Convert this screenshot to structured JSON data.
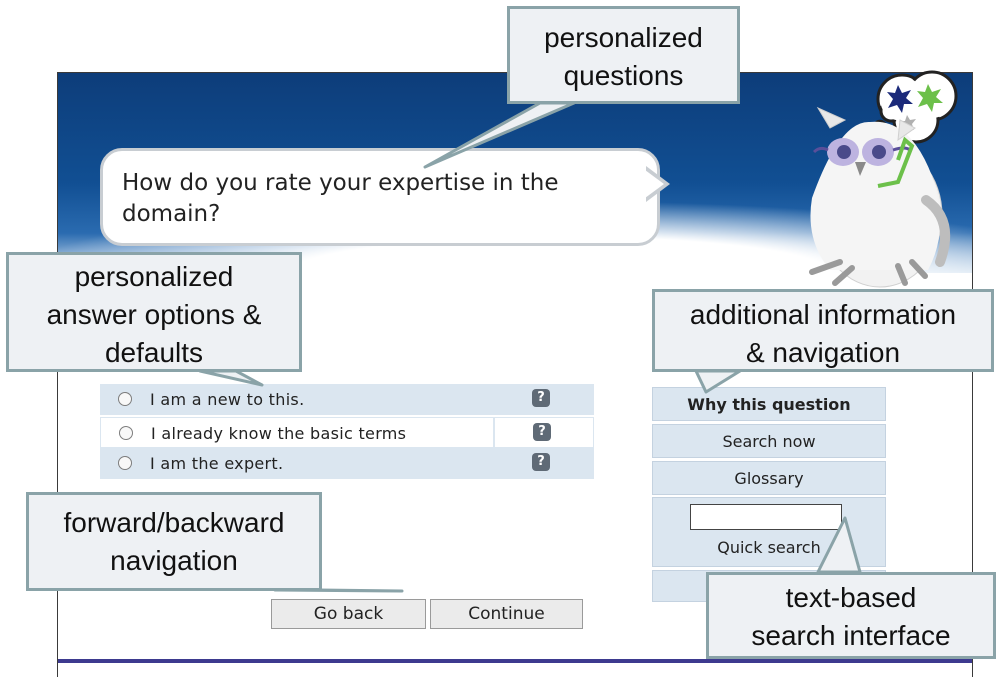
{
  "question": {
    "text": "How do you rate your expertise in the domain?"
  },
  "answers": [
    {
      "label": "I am a new to this.",
      "help": "?"
    },
    {
      "label": "I already know the basic terms",
      "help": "?"
    },
    {
      "label": "I am the expert.",
      "help": "?"
    }
  ],
  "nav": {
    "back_label": "Go back",
    "continue_label": "Continue"
  },
  "side": {
    "why_label": "Why this question",
    "search_now_label": "Search now",
    "glossary_label": "Glossary",
    "quick_search_label": "Quick search",
    "quick_search_value": ""
  },
  "callouts": {
    "personalized_questions": [
      "personalized",
      "questions"
    ],
    "answer_options": [
      "personalized",
      "answer options &",
      "defaults"
    ],
    "additional_info": [
      "additional information",
      "& navigation"
    ],
    "forward_backward": [
      "forward/backward",
      "navigation"
    ],
    "text_search": [
      "text-based",
      "search interface"
    ]
  },
  "colors": {
    "header_blue": "#114f93",
    "row_shade": "#dbe6f0",
    "callout_border": "#8aa3a8",
    "footer_line": "#3d3a8f"
  },
  "icons": {
    "help": "question-mark-icon",
    "owl": "owl-mascot",
    "thought": "thought-bubble-stars"
  }
}
